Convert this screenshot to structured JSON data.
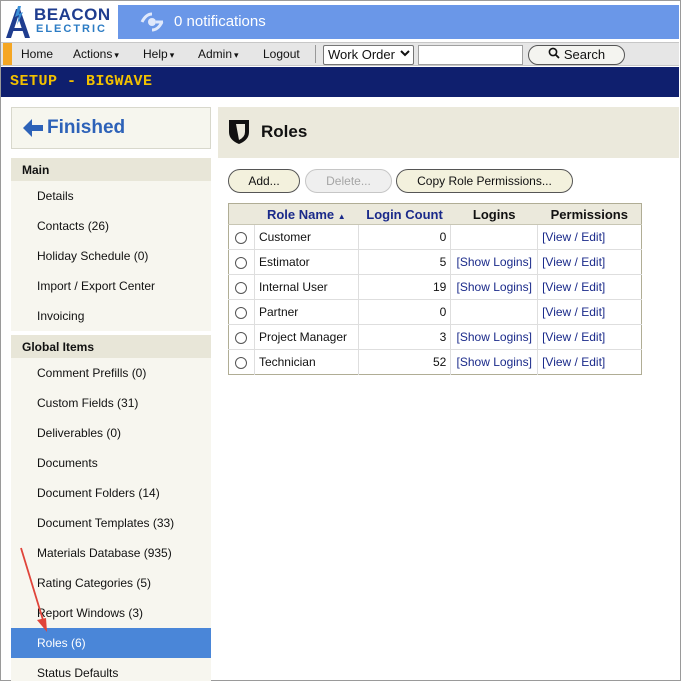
{
  "brand": {
    "line1": "BEACON",
    "line2": "ELECTRIC"
  },
  "notifications": {
    "label": "0 notifications"
  },
  "nav": {
    "items": [
      {
        "label": "Home"
      },
      {
        "label": "Actions"
      },
      {
        "label": "Help"
      },
      {
        "label": "Admin"
      },
      {
        "label": "Logout"
      }
    ],
    "caret": "▾",
    "select_value": "Work Order",
    "search_value": "",
    "search_label": "Search"
  },
  "setup_title": "SETUP - BIGWAVE",
  "sidebar": {
    "finished_label": "Finished",
    "sections": [
      {
        "header": "Main",
        "items": [
          "Details",
          "Contacts (26)",
          "Holiday Schedule (0)",
          "Import / Export Center",
          "Invoicing"
        ]
      },
      {
        "header": "Global Items",
        "items": [
          "Comment Prefills (0)",
          "Custom Fields (31)",
          "Deliverables (0)",
          "Documents",
          "Document Folders (14)",
          "Document Templates (33)",
          "Materials Database (935)",
          "Rating Categories (5)",
          "Report Windows (3)",
          "Roles (6)",
          "Status Defaults"
        ]
      }
    ],
    "active_item": "Roles (6)"
  },
  "page": {
    "title": "Roles",
    "buttons": {
      "add": "Add...",
      "delete": "Delete...",
      "copy": "Copy Role Permissions..."
    }
  },
  "table": {
    "headers": {
      "name": "Role Name",
      "count": "Login Count",
      "logins": "Logins",
      "perms": "Permissions"
    },
    "sort_indicator": "▲",
    "rows": [
      {
        "name": "Customer",
        "count": "0",
        "logins": "",
        "perms": "[View / Edit]"
      },
      {
        "name": "Estimator",
        "count": "5",
        "logins": "[Show Logins]",
        "perms": "[View / Edit]"
      },
      {
        "name": "Internal User",
        "count": "19",
        "logins": "[Show Logins]",
        "perms": "[View / Edit]"
      },
      {
        "name": "Partner",
        "count": "0",
        "logins": "",
        "perms": "[View / Edit]"
      },
      {
        "name": "Project Manager",
        "count": "3",
        "logins": "[Show Logins]",
        "perms": "[View / Edit]"
      },
      {
        "name": "Technician",
        "count": "52",
        "logins": "[Show Logins]",
        "perms": "[View / Edit]"
      }
    ]
  },
  "colors": {
    "notif_bar": "#6a97e8",
    "setup_bar": "#0f1f6e",
    "setup_text": "#f2c000",
    "active_item": "#4a86d8",
    "accent": "#f5a623",
    "annotation_arrow": "#e0443a"
  },
  "icons": {
    "logo": "beacon-tower-icon",
    "notifications": "eye-radar-icon",
    "finished": "arrow-left-icon",
    "page": "shield-icon",
    "search": "magnifier-icon",
    "select": "chevron-down-icon"
  }
}
